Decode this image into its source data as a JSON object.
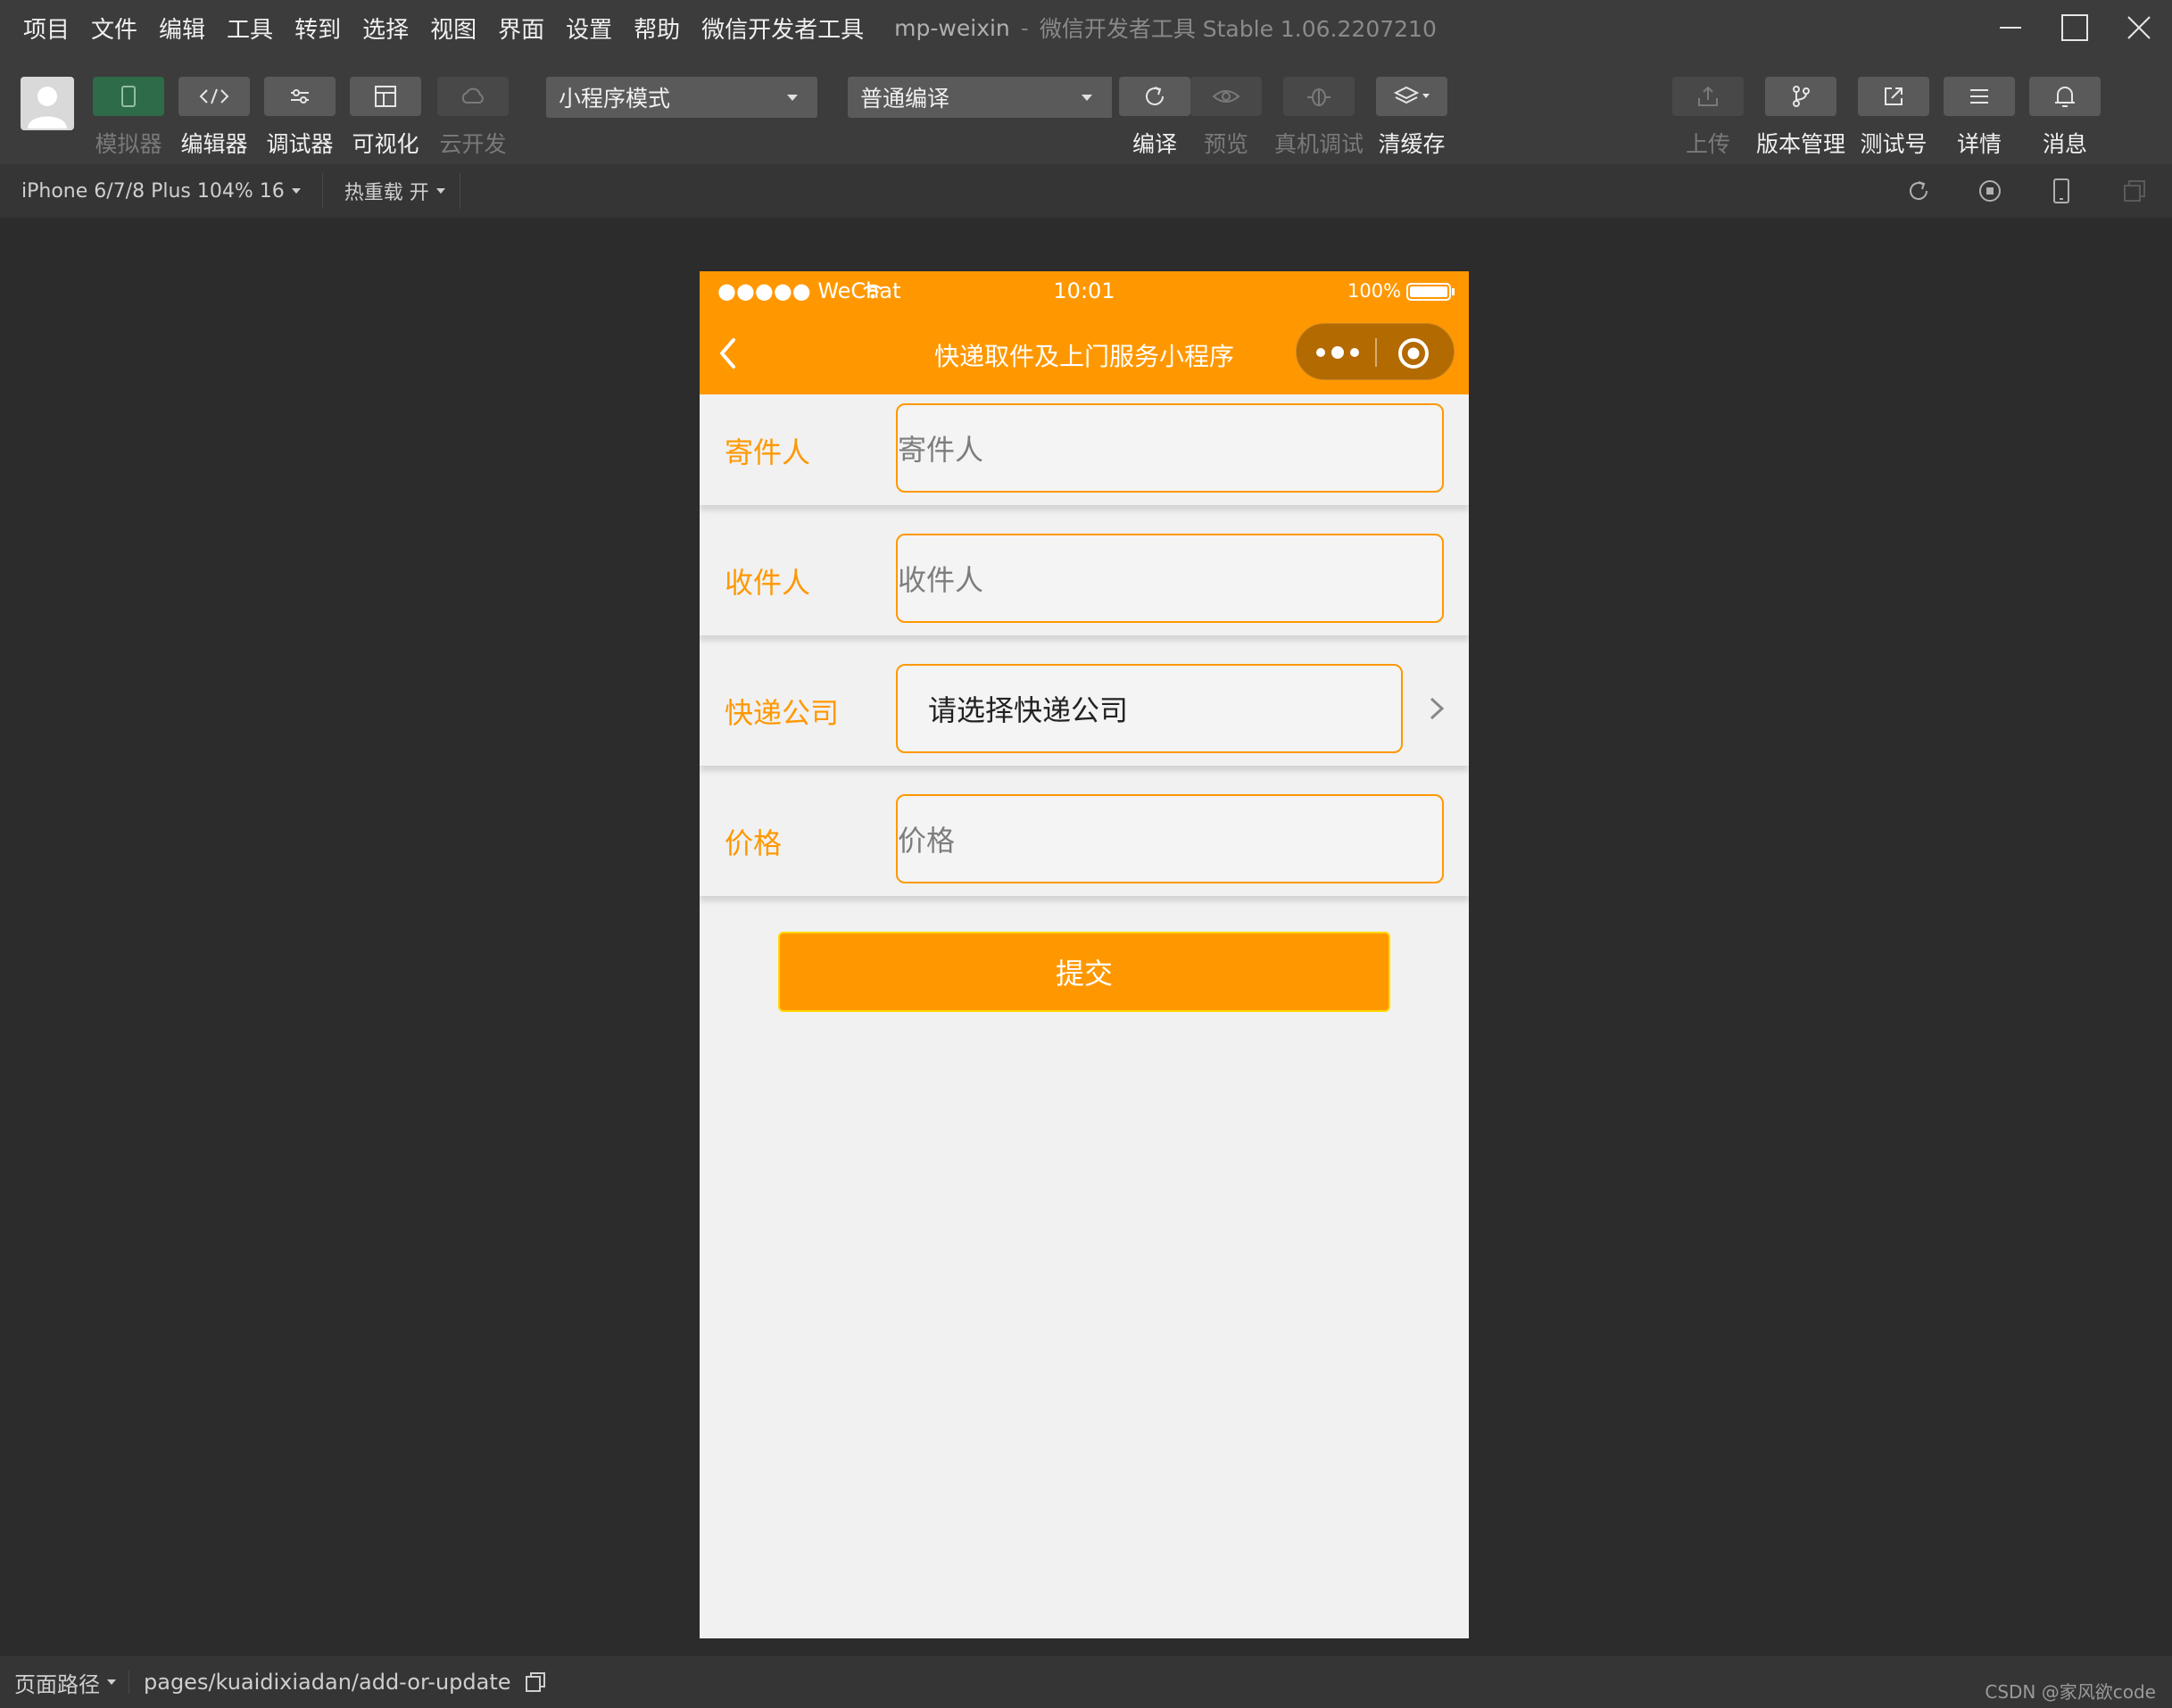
{
  "menubar": {
    "items": [
      "项目",
      "文件",
      "编辑",
      "工具",
      "转到",
      "选择",
      "视图",
      "界面",
      "设置",
      "帮助",
      "微信开发者工具"
    ],
    "app_name": "mp-weixin",
    "separator": "-",
    "tool_title": "微信开发者工具 Stable 1.06.2207210"
  },
  "toolbar": {
    "simulator": "模拟器",
    "editor": "编辑器",
    "debugger": "调试器",
    "visual": "可视化",
    "cloud": "云开发",
    "mode_select": "小程序模式",
    "compile_select": "普通编译",
    "compile": "编译",
    "preview": "预览",
    "real_debug": "真机调试",
    "clear_cache": "清缓存",
    "upload": "上传",
    "version": "版本管理",
    "test_account": "测试号",
    "details": "详情",
    "messages": "消息"
  },
  "subbar": {
    "device": "iPhone 6/7/8 Plus 104% 16",
    "hot_reload": "热重载 开"
  },
  "phone": {
    "status": {
      "signal": "●●●●● WeChat",
      "time": "10:01",
      "battery": "100%"
    },
    "nav_title": "快递取件及上门服务小程序",
    "form": {
      "sender_label": "寄件人",
      "sender_placeholder": "寄件人",
      "receiver_label": "收件人",
      "receiver_placeholder": "收件人",
      "company_label": "快递公司",
      "company_value": "请选择快递公司",
      "price_label": "价格",
      "price_placeholder": "价格"
    },
    "submit": "提交"
  },
  "footer": {
    "path_label": "页面路径",
    "path": "pages/kuaidixiadan/add-or-update",
    "watermark": "CSDN @家风欲code"
  },
  "colors": {
    "accent": "#ff9800",
    "toolbar_bg": "#3c3c3c",
    "workspace_bg": "#2c2c2c"
  }
}
